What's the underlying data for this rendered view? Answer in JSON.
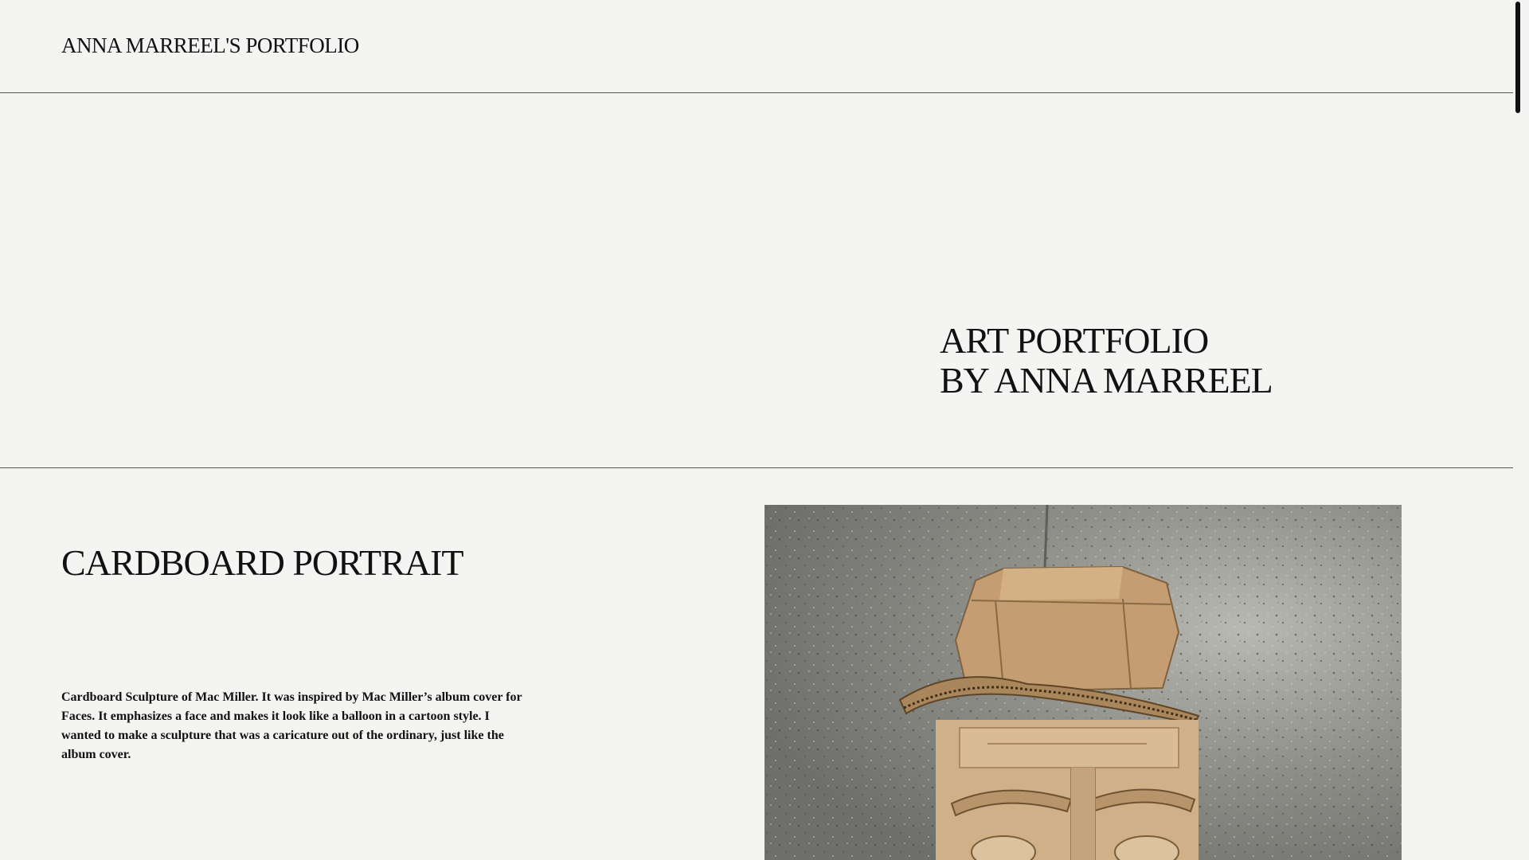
{
  "header": {
    "site_title": "ANNA MARREEL'S PORTFOLIO"
  },
  "hero": {
    "title_line1": "ART PORTFOLIO",
    "title_line2": "BY ANNA MARREEL"
  },
  "project": {
    "title": "CARDBOARD PORTRAIT",
    "description": "Cardboard Sculpture of Mac Miller. It was inspired by Mac Miller’s album cover for Faces. It emphasizes a face and makes it look like a balloon in a cartoon style. I wanted to make a sculpture that was a caricature out of the ordinary, just like the album cover.",
    "image_subject": "cardboard-sculpture-photo"
  },
  "colors": {
    "background": "#f4f4f2",
    "text": "#111111",
    "divider": "#555555",
    "cardboard": "#c9a77c",
    "floor": "#8d8d89"
  }
}
